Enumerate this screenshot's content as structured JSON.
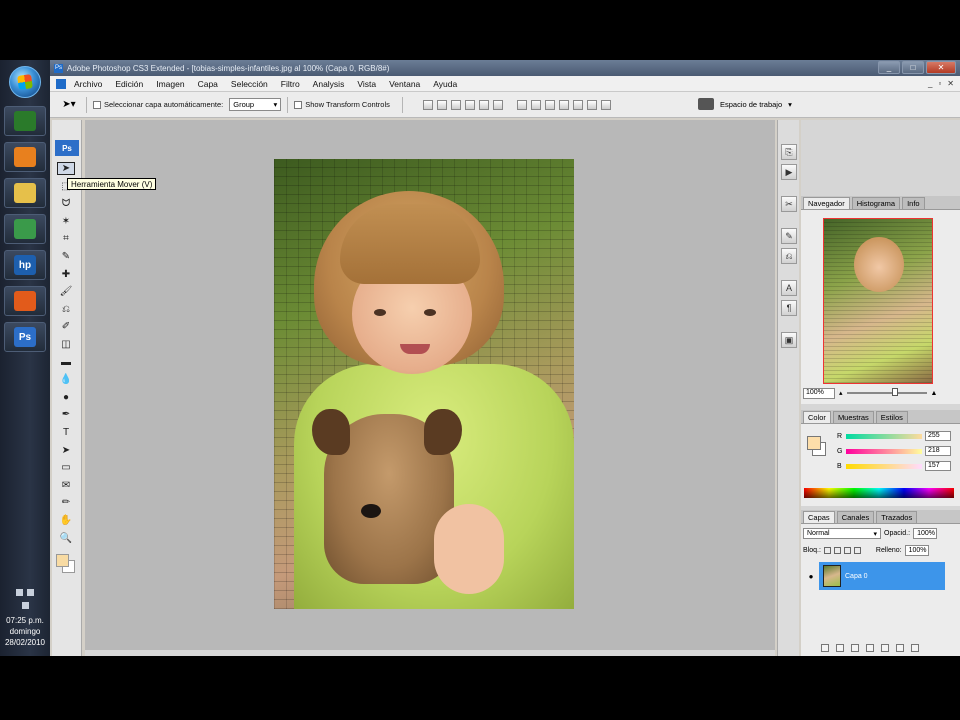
{
  "taskbar": {
    "apps": [
      {
        "icon": "messenger-icon",
        "color": "#2a7a2a"
      },
      {
        "icon": "media-player-icon",
        "color": "#e8801e"
      },
      {
        "icon": "folder-icon",
        "color": "#e6c04a"
      },
      {
        "icon": "gadgets-icon",
        "color": "#3a9a4a"
      },
      {
        "icon": "hp-icon",
        "color": "#1d5fae",
        "label": "hp"
      },
      {
        "icon": "firefox-icon",
        "color": "#e25b1b"
      },
      {
        "icon": "photoshop-icon",
        "color": "#2c6ec8",
        "label": "Ps"
      }
    ],
    "clock": {
      "time": "07:25 p.m.",
      "day": "domingo",
      "date": "28/02/2010"
    }
  },
  "window": {
    "title": "Adobe Photoshop CS3 Extended - [tobias-simples-infantiles.jpg al 100% (Capa 0, RGB/8#)",
    "buttons": {
      "minimize": "_",
      "maximize": "□",
      "close": "✕"
    }
  },
  "menu": {
    "items": [
      "Archivo",
      "Edición",
      "Imagen",
      "Capa",
      "Selección",
      "Filtro",
      "Analysis",
      "Vista",
      "Ventana",
      "Ayuda"
    ],
    "mdi": [
      "_",
      "▫",
      "✕"
    ]
  },
  "options": {
    "auto_select_label": "Seleccionar capa automáticamente:",
    "auto_select_value": "Group",
    "transform_label": "Show Transform Controls",
    "workspace_label": "Espacio de trabajo"
  },
  "tools": {
    "badge": "Ps",
    "tooltip": "Herramienta Mover (V)",
    "items": [
      "move-tool-icon",
      "marquee-tool-icon",
      "lasso-tool-icon",
      "magic-wand-tool-icon",
      "crop-tool-icon",
      "eyedropper-tool-icon",
      "healing-brush-tool-icon",
      "brush-tool-icon",
      "clone-stamp-tool-icon",
      "history-brush-tool-icon",
      "eraser-tool-icon",
      "gradient-tool-icon",
      "blur-tool-icon",
      "dodge-tool-icon",
      "pen-tool-icon",
      "type-tool-icon",
      "path-selection-tool-icon",
      "shape-tool-icon",
      "notes-tool-icon",
      "eyedropper-tool-icon-2",
      "hand-tool-icon",
      "zoom-tool-icon"
    ],
    "glyphs": [
      "➤",
      "⬚",
      "ᗢ",
      "✶",
      "⌗",
      "✎",
      "✚",
      "🖌",
      "⎌",
      "✐",
      "◫",
      "▬",
      "💧",
      "●",
      "✒",
      "T",
      "➤",
      "▭",
      "✉",
      "✏",
      "✋",
      "🔍"
    ],
    "foreground_color": "#f8dba3",
    "background_color": "#ffffff"
  },
  "navigator": {
    "tabs": [
      "Navegador",
      "Histograma",
      "Info"
    ],
    "zoom": "100%"
  },
  "color": {
    "tabs": [
      "Color",
      "Muestras",
      "Estilos"
    ],
    "channels": [
      {
        "name": "R",
        "value": "255",
        "pos": 0.99
      },
      {
        "name": "G",
        "value": "218",
        "pos": 0.85
      },
      {
        "name": "B",
        "value": "157",
        "pos": 0.62
      }
    ],
    "foreground": "#fddeaa"
  },
  "layers": {
    "tabs": [
      "Capas",
      "Canales",
      "Trazados"
    ],
    "blend_mode": "Normal",
    "opacity_label": "Opacid.:",
    "opacity": "100%",
    "lock_label": "Bloq.:",
    "fill_label": "Relleno:",
    "fill": "100%",
    "items": [
      {
        "name": "Capa 0"
      }
    ]
  }
}
